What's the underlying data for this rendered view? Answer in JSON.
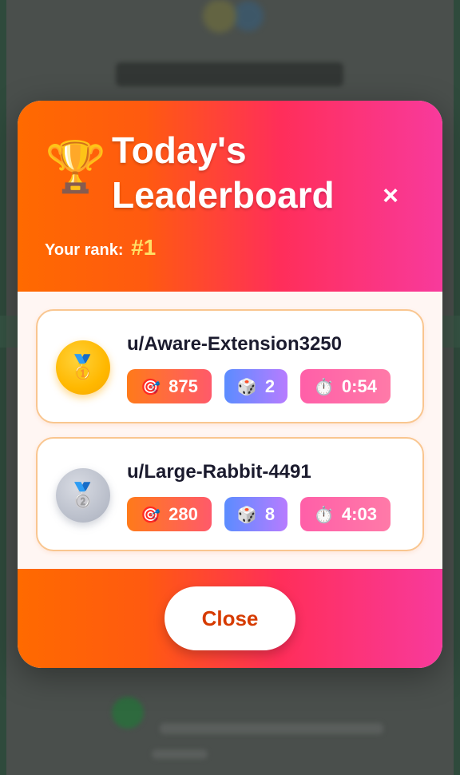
{
  "modal": {
    "title": "Today's Leaderboard",
    "close_icon": "×",
    "rank_label": "Your rank:",
    "rank_value": "#1",
    "trophy_icon": "🏆"
  },
  "entries": [
    {
      "medal_icon": "🥇",
      "username": "u/Aware-Extension3250",
      "score_icon": "🎯",
      "score": "875",
      "dice_icon": "🎲",
      "dice": "2",
      "time_icon": "⏱️",
      "time": "0:54"
    },
    {
      "medal_icon": "🥈",
      "username": "u/Large-Rabbit-4491",
      "score_icon": "🎯",
      "score": "280",
      "dice_icon": "🎲",
      "dice": "8",
      "time_icon": "⏱️",
      "time": "4:03"
    }
  ],
  "footer": {
    "close_label": "Close"
  },
  "colors": {
    "header_start": "#ff6a00",
    "header_end": "#f83a9c",
    "rank_highlight": "#ffe066",
    "close_text": "#d63b00",
    "card_border": "#f9c690"
  }
}
